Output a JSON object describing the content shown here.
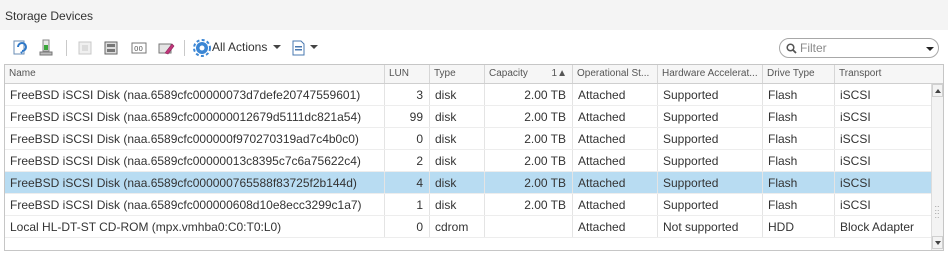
{
  "panel": {
    "title": "Storage Devices"
  },
  "toolbar": {
    "actions_label": "All Actions",
    "icons": [
      "refresh-icon",
      "attach-icon",
      "rescan-disabled-icon",
      "storage-icon",
      "serial-icon",
      "erase-partitions-icon",
      "gear-icon",
      "export-icon"
    ]
  },
  "filter": {
    "placeholder": "Filter"
  },
  "table": {
    "columns": [
      "Name",
      "LUN",
      "Type",
      "Capacity",
      "1▲",
      "Operational St...",
      "Hardware Accelerat...",
      "Drive Type",
      "Transport"
    ],
    "sort_indicator": "1▲",
    "rows": [
      {
        "name": "FreeBSD iSCSI Disk (naa.6589cfc00000073d7defe20747559601)",
        "lun": "3",
        "type": "disk",
        "capacity": "2.00 TB",
        "status": "Attached",
        "hw": "Supported",
        "drive": "Flash",
        "transport": "iSCSI"
      },
      {
        "name": "FreeBSD iSCSI Disk (naa.6589cfc000000012679d5111dc821a54)",
        "lun": "99",
        "type": "disk",
        "capacity": "2.00 TB",
        "status": "Attached",
        "hw": "Supported",
        "drive": "Flash",
        "transport": "iSCSI"
      },
      {
        "name": "FreeBSD iSCSI Disk (naa.6589cfc000000f970270319ad7c4b0c0)",
        "lun": "0",
        "type": "disk",
        "capacity": "2.00 TB",
        "status": "Attached",
        "hw": "Supported",
        "drive": "Flash",
        "transport": "iSCSI"
      },
      {
        "name": "FreeBSD iSCSI Disk (naa.6589cfc00000013c8395c7c6a75622c4)",
        "lun": "2",
        "type": "disk",
        "capacity": "2.00 TB",
        "status": "Attached",
        "hw": "Supported",
        "drive": "Flash",
        "transport": "iSCSI"
      },
      {
        "name": "FreeBSD iSCSI Disk (naa.6589cfc000000765588f83725f2b144d)",
        "lun": "4",
        "type": "disk",
        "capacity": "2.00 TB",
        "status": "Attached",
        "hw": "Supported",
        "drive": "Flash",
        "transport": "iSCSI"
      },
      {
        "name": "FreeBSD iSCSI Disk (naa.6589cfc000000608d10e8ecc3299c1a7)",
        "lun": "1",
        "type": "disk",
        "capacity": "2.00 TB",
        "status": "Attached",
        "hw": "Supported",
        "drive": "Flash",
        "transport": "iSCSI"
      },
      {
        "name": "Local HL-DT-ST CD-ROM (mpx.vmhba0:C0:T0:L0)",
        "lun": "0",
        "type": "cdrom",
        "capacity": "",
        "status": "Attached",
        "hw": "Not supported",
        "drive": "HDD",
        "transport": "Block Adapter"
      }
    ],
    "selected_row": 4
  },
  "colors": {
    "selected_row": "#b8dcf2",
    "accent": "#1a73c4"
  }
}
